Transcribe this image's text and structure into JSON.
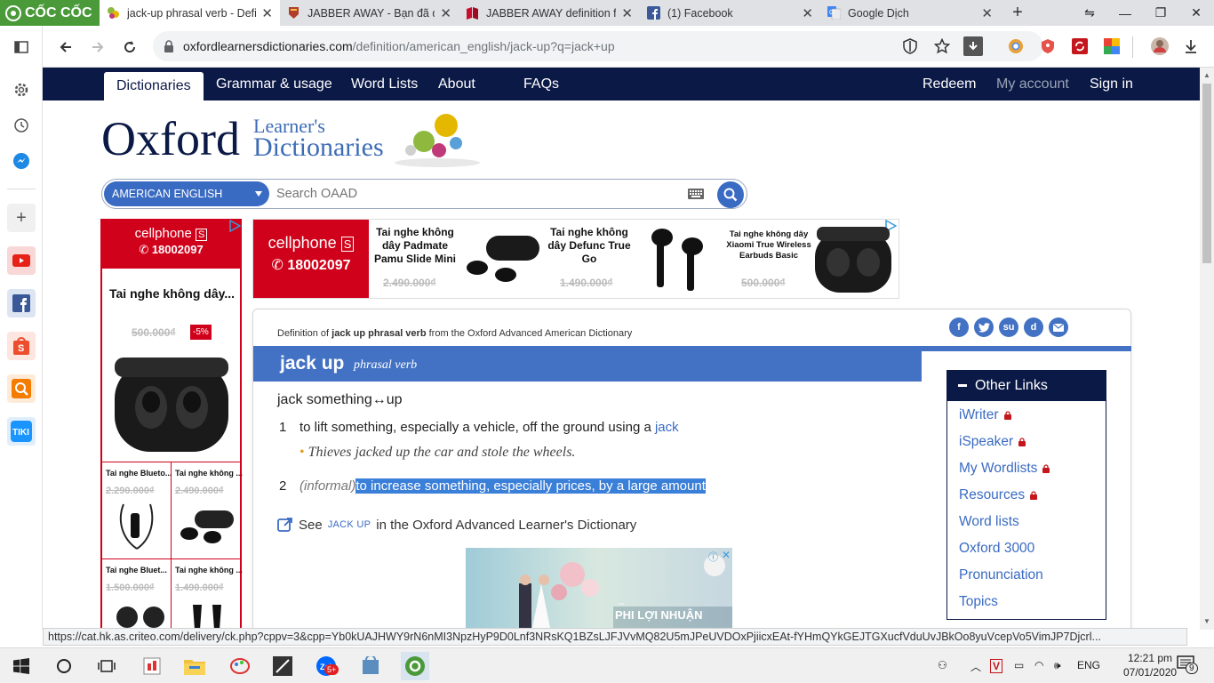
{
  "browser": {
    "brand": "CỐC CỐC",
    "tabs": [
      {
        "title": "jack-up phrasal verb - Defin",
        "active": true
      },
      {
        "title": "JABBER AWAY - Bạn đã đánh",
        "active": false
      },
      {
        "title": "JABBER AWAY definition fro",
        "active": false
      },
      {
        "title": "(1) Facebook",
        "active": false
      },
      {
        "title": "Google Dịch",
        "active": false
      }
    ],
    "url_domain": "oxfordlearnersdictionaries.com",
    "url_path": "/definition/american_english/jack-up?q=jack+up",
    "status_url": "https://cat.hk.as.criteo.com/delivery/ck.php?cppv=3&cpp=Yb0kUAJHWY9rN6nMI3NpzHyP9D0Lnf3NRsKQ1BZsLJFJVvMQ82U5mJPeUVDOxPjiicxEAt-fYHmQYkGEJTGXucfVduUvJBkOo8yuVcepVo5VimJP7Djcrl..."
  },
  "site_nav": {
    "left": [
      "Dictionaries",
      "Grammar & usage",
      "Word Lists",
      "About",
      "FAQs"
    ],
    "right": [
      "Redeem",
      "My account",
      "Sign in"
    ]
  },
  "logo": {
    "oxford": "Oxford",
    "line1": "Learner's",
    "line2": "Dictionaries"
  },
  "search": {
    "dictionary": "AMERICAN ENGLISH",
    "placeholder": "Search OAAD"
  },
  "ads": {
    "brand": "cellphone",
    "phone": "18002097",
    "side_title": "Tai nghe không dây...",
    "side_price": "500.000₫",
    "side_discount": "-5%",
    "grid": [
      {
        "name": "Tai nghe Blueto...",
        "price": "2.290.000₫"
      },
      {
        "name": "Tai nghe không ...",
        "price": "2.490.000₫"
      },
      {
        "name": "Tai nghe Bluet...",
        "price": "1.500.000₫"
      },
      {
        "name": "Tai nghe không ...",
        "price": "1.490.000₫"
      }
    ],
    "banner": [
      {
        "name": "Tai nghe không dây Padmate Pamu Slide Mini",
        "price": "2.490.000₫"
      },
      {
        "name": "Tai nghe không dây Defunc True Go",
        "price": "1.490.000₫"
      },
      {
        "name": "Tai nghe không dây Xiaomi True Wireless Earbuds Basic",
        "price": "500.000₫"
      }
    ],
    "bottom_text": "PHI LỢI NHUẬN"
  },
  "entry": {
    "def_prefix": "Definition of ",
    "def_word": "jack up phrasal verb",
    "def_suffix": " from the Oxford Advanced American Dictionary",
    "headword": "jack up",
    "pos": "phrasal verb",
    "pattern": "jack something↔up",
    "senses": [
      {
        "num": "1",
        "def_before": "to lift something, especially a vehicle, off the ground using a ",
        "xref": "jack",
        "example": "Thieves jacked up the car and stole the wheels."
      },
      {
        "num": "2",
        "label": "(informal)",
        "def": "to increase something, especially prices, by a large amount"
      }
    ],
    "see_also": {
      "see": "See",
      "xref": "JACK UP",
      "rest": "in the Oxford Advanced Learner's Dictionary"
    }
  },
  "other_links": {
    "title": "Other Links",
    "items": [
      {
        "label": "iWriter",
        "locked": true
      },
      {
        "label": "iSpeaker",
        "locked": true
      },
      {
        "label": "My Wordlists",
        "locked": true
      },
      {
        "label": "Resources",
        "locked": true
      },
      {
        "label": "Word lists",
        "locked": false
      },
      {
        "label": "Oxford 3000",
        "locked": false
      },
      {
        "label": "Pronunciation",
        "locked": false
      },
      {
        "label": "Topics",
        "locked": false
      }
    ]
  },
  "taskbar": {
    "time": "12:21 pm",
    "date": "07/01/2020",
    "lang": "ENG",
    "notif_count": "9",
    "zalo_badge": "5+"
  },
  "colors": {
    "oxford_navy": "#0b1946",
    "oxford_blue": "#4372c4",
    "highlight": "#3a7fd8",
    "cellphones_red": "#d0021b"
  }
}
